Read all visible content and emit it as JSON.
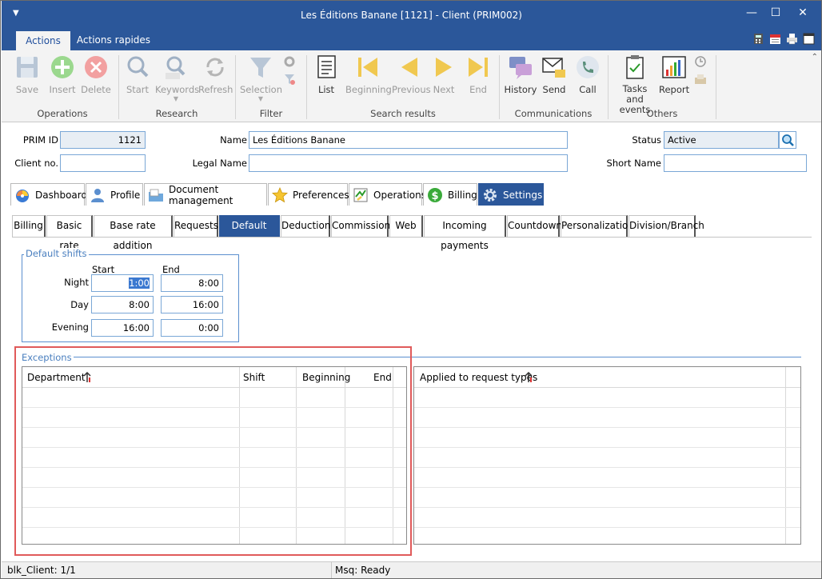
{
  "window": {
    "title": "Les Éditions Banane [1121] - Client (PRIM002)",
    "system_menu_icon": "menu-arrow-icon",
    "minimize_icon": "minimize-icon",
    "maximize_icon": "maximize-icon",
    "close_icon": "close-icon"
  },
  "menubar": {
    "tabs": [
      {
        "label": "Actions"
      },
      {
        "label": "Actions rapides"
      }
    ],
    "active_tab": "Actions",
    "right_icons": [
      "calculator-icon",
      "calendar-icon",
      "printer-icon",
      "window-icon"
    ]
  },
  "ribbon": {
    "operations": {
      "group": "Operations",
      "save": "Save",
      "insert": "Insert",
      "delete": "Delete"
    },
    "research": {
      "group": "Research",
      "start": "Start",
      "keywords": "Keywords",
      "refresh": "Refresh"
    },
    "filter": {
      "group": "Filter",
      "selection": "Selection"
    },
    "search_results": {
      "group": "Search results",
      "list": "List",
      "beginning": "Beginning",
      "previous": "Previous",
      "next": "Next",
      "end": "End"
    },
    "communications": {
      "group": "Communications",
      "history": "History",
      "send": "Send",
      "call": "Call"
    },
    "others": {
      "group": "Others",
      "tasks": "Tasks and\nevents",
      "report": "Report"
    }
  },
  "form": {
    "prim_id_label": "PRIM ID",
    "prim_id": "1121",
    "name_label": "Name",
    "name": "Les Éditions Banane",
    "status_label": "Status",
    "status": "Active",
    "client_no_label": "Client no.",
    "client_no": "",
    "legal_name_label": "Legal Name",
    "legal_name": "",
    "short_name_label": "Short Name",
    "short_name": ""
  },
  "main_tabs": [
    {
      "label": "Dashboard",
      "icon": "dashboard-icon"
    },
    {
      "label": "Profile",
      "icon": "person-icon"
    },
    {
      "label": "Document management",
      "icon": "folder-icon"
    },
    {
      "label": "Preferences",
      "icon": "star-icon"
    },
    {
      "label": "Operations",
      "icon": "operations-icon"
    },
    {
      "label": "Billing",
      "icon": "dollar-icon"
    },
    {
      "label": "Settings",
      "icon": "gear-icon"
    }
  ],
  "active_main_tab": "Settings",
  "sub_tabs": [
    "Billing",
    "Basic rate",
    "Base rate addition",
    "Requests",
    "Default hours",
    "Deductions",
    "Commissions",
    "Web",
    "Incoming payments",
    "Countdown",
    "Personalization",
    "Division/Branch"
  ],
  "active_sub_tab": "Default hours",
  "default_shifts": {
    "legend": "Default shifts",
    "start_header": "Start",
    "end_header": "End",
    "rows": [
      {
        "label": "Night",
        "start": "1:00",
        "end": "8:00"
      },
      {
        "label": "Day",
        "start": "8:00",
        "end": "16:00"
      },
      {
        "label": "Evening",
        "start": "16:00",
        "end": "0:00"
      }
    ]
  },
  "exceptions": {
    "legend": "Exceptions",
    "columns": [
      "Department",
      "Shift",
      "Beginning",
      "End"
    ],
    "request_types_header": "Applied to request types",
    "sort_icon": "sort-ascending-icon"
  },
  "statusbar": {
    "left": "blk_Client: 1/1",
    "right": "Msq: Ready"
  },
  "colors": {
    "accent": "#2b579a",
    "highlight": "#e05a5a"
  }
}
